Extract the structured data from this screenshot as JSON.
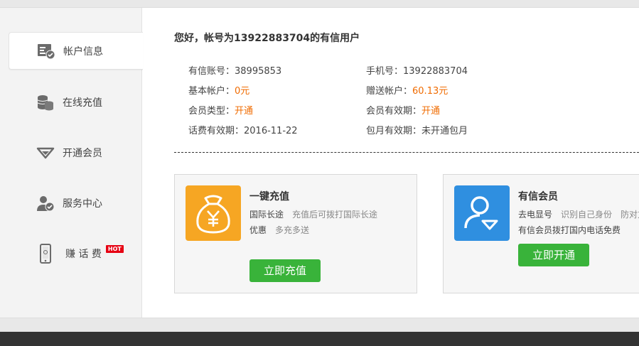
{
  "sidebar": {
    "items": [
      {
        "label": "帐户信息",
        "icon": "account-card-icon",
        "active": true
      },
      {
        "label": "在线充值",
        "icon": "coins-icon",
        "active": false
      },
      {
        "label": "开通会员",
        "icon": "diamond-icon",
        "active": false
      },
      {
        "label": "服务中心",
        "icon": "user-check-icon",
        "active": false
      },
      {
        "label": "赚 话 费",
        "icon": "phone-icon",
        "active": false,
        "badge": "HOT"
      }
    ]
  },
  "account": {
    "greeting": "您好，帐号为13922883704的有信用户",
    "rows": {
      "youxin_id_label": "有信账号：",
      "youxin_id": "38995853",
      "phone_label": "手机号：",
      "phone": "13922883704",
      "basic_label": "基本帐户：",
      "basic": "0元",
      "gift_label": "赠送帐户：",
      "gift": "60.13元",
      "member_type_label": "会员类型：",
      "member_type": "开通",
      "member_valid_label": "会员有效期：",
      "member_valid": "开通",
      "call_valid_label": "话费有效期：",
      "call_valid": "2016-11-22",
      "monthly_valid_label": "包月有效期：",
      "monthly_valid": "未开通包月"
    }
  },
  "cards": {
    "recharge": {
      "title": "一键充值",
      "line1_a": "国际长途",
      "line1_b": "充值后可拨打国际长途",
      "line2_a": "优惠",
      "line2_b": "多充多送",
      "button": "立即充值"
    },
    "member": {
      "title": "有信会员",
      "line1_a": "去电显号",
      "line1_b": "识别自己身份　防对方",
      "line2": "有信会员拨打国内电话免费",
      "button": "立即开通"
    }
  },
  "colors": {
    "accent_orange": "#f06b00",
    "button_green": "#39b33a",
    "hot_red": "#e60012",
    "recharge_icon": "#f6a623",
    "member_icon": "#2f8fe0"
  }
}
